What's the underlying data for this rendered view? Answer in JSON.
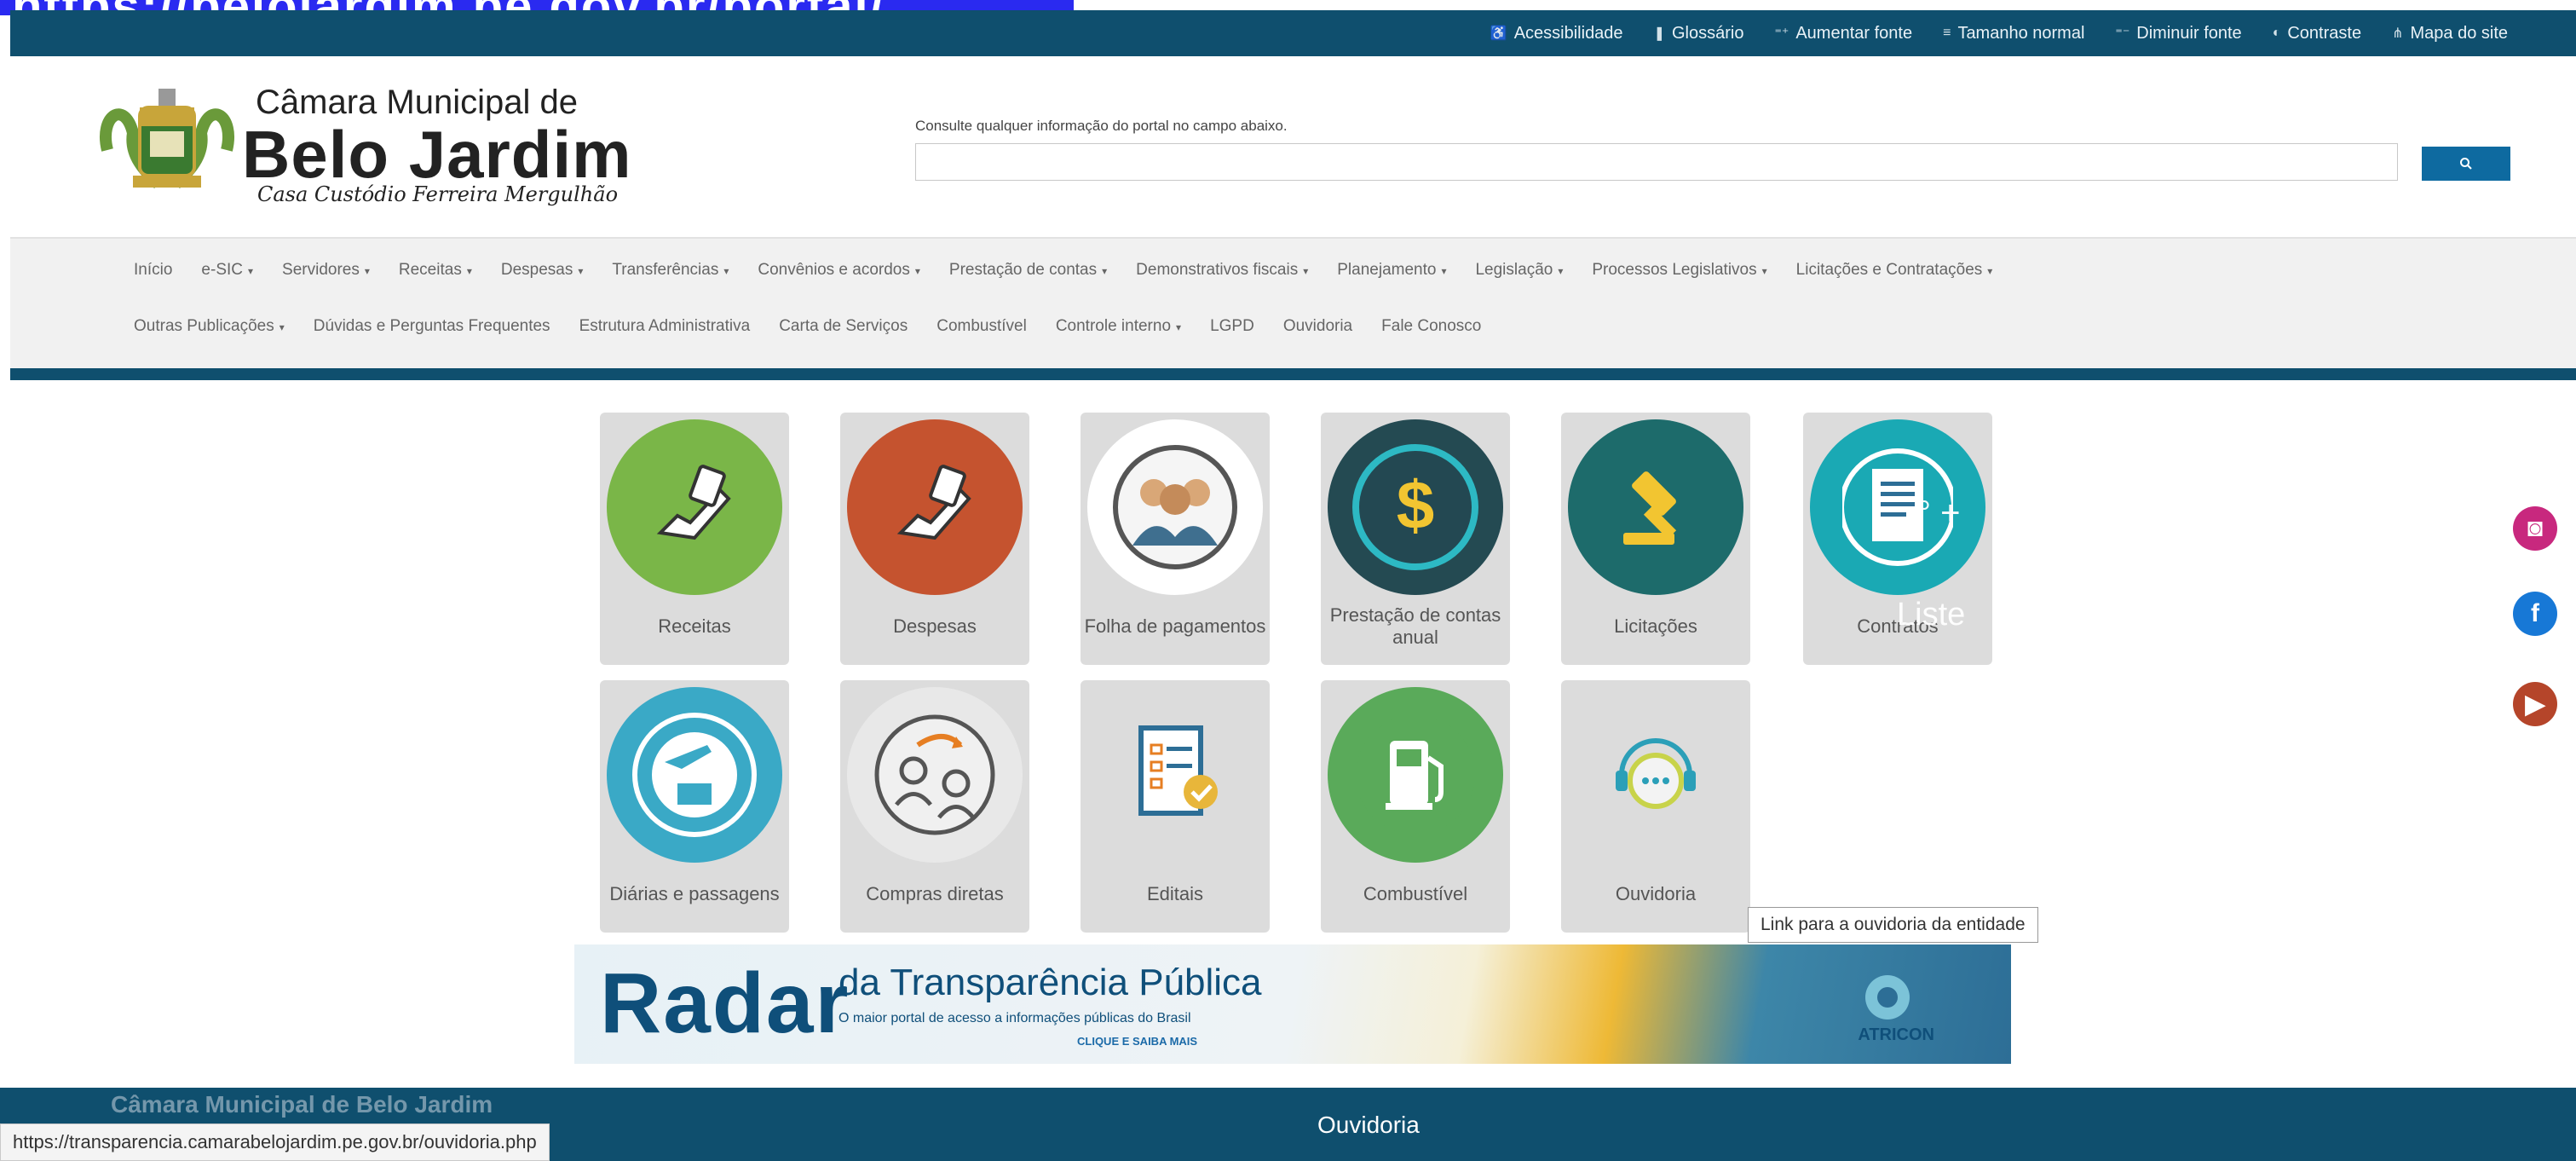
{
  "top_overlay_url": "https://belojardim.pe.gov.br/portal/",
  "access_bar": {
    "items": [
      {
        "icon": "accessibility-icon",
        "glyph": "♿",
        "label": "Acessibilidade"
      },
      {
        "icon": "book-icon",
        "glyph": "❚",
        "label": "Glossário"
      },
      {
        "icon": "font-increase-icon",
        "glyph": "⁼⁺",
        "label": "Aumentar fonte"
      },
      {
        "icon": "font-normal-icon",
        "glyph": "≡",
        "label": "Tamanho normal"
      },
      {
        "icon": "font-decrease-icon",
        "glyph": "⁼⁻",
        "label": "Diminuir fonte"
      },
      {
        "icon": "contrast-icon",
        "glyph": "◐",
        "label": "Contraste"
      },
      {
        "icon": "sitemap-icon",
        "glyph": "⋔",
        "label": "Mapa do site"
      }
    ]
  },
  "header": {
    "logo_line1": "Câmara Municipal de",
    "logo_line2": "Belo Jardim",
    "logo_line3": "Casa Custódio Ferreira Mergulhão",
    "search_label": "Consulte qualquer informação do portal no campo abaixo.",
    "search_value": ""
  },
  "nav": {
    "row1": [
      {
        "label": "Início",
        "dropdown": false
      },
      {
        "label": "e-SIC",
        "dropdown": true
      },
      {
        "label": "Servidores",
        "dropdown": true
      },
      {
        "label": "Receitas",
        "dropdown": true
      },
      {
        "label": "Despesas",
        "dropdown": true
      },
      {
        "label": "Transferências",
        "dropdown": true
      },
      {
        "label": "Convênios e acordos",
        "dropdown": true
      },
      {
        "label": "Prestação de contas",
        "dropdown": true
      },
      {
        "label": "Demonstrativos fiscais",
        "dropdown": true
      },
      {
        "label": "Planejamento",
        "dropdown": true
      },
      {
        "label": "Legislação",
        "dropdown": true
      },
      {
        "label": "Processos Legislativos",
        "dropdown": true
      },
      {
        "label": "Licitações e Contratações",
        "dropdown": true
      }
    ],
    "row2": [
      {
        "label": "Outras Publicações",
        "dropdown": true
      },
      {
        "label": "Dúvidas e Perguntas Frequentes",
        "dropdown": false
      },
      {
        "label": "Estrutura Administrativa",
        "dropdown": false
      },
      {
        "label": "Carta de Serviços",
        "dropdown": false
      },
      {
        "label": "Combustível",
        "dropdown": false
      },
      {
        "label": "Controle interno",
        "dropdown": true
      },
      {
        "label": "LGPD",
        "dropdown": false
      },
      {
        "label": "Ouvidoria",
        "dropdown": false
      },
      {
        "label": "Fale Conosco",
        "dropdown": false
      }
    ]
  },
  "tiles": [
    {
      "label": "Receitas",
      "icon": "money-hand-icon",
      "color": "#7ab648"
    },
    {
      "label": "Despesas",
      "icon": "money-hand-icon",
      "color": "#c5532f"
    },
    {
      "label": "Folha de pagamentos",
      "icon": "people-group-icon",
      "color": "#ffffff"
    },
    {
      "label": "Prestação de contas anual",
      "icon": "dollar-icon",
      "color": "#244a52"
    },
    {
      "label": "Licitações",
      "icon": "gavel-icon",
      "color": "#1d6b6b"
    },
    {
      "label": "Contratos",
      "icon": "document-icon",
      "color": "#1aa9b4"
    },
    {
      "label": "Diárias e passagens",
      "icon": "travel-icon",
      "color": "#3aa9c6"
    },
    {
      "label": "Compras diretas",
      "icon": "exchange-users-icon",
      "color": "#e8e8e8"
    },
    {
      "label": "Editais",
      "icon": "checklist-icon",
      "color": "#dcdcdc"
    },
    {
      "label": "Combustível",
      "icon": "fuel-pump-icon",
      "color": "#5aaa5a"
    },
    {
      "label": "Ouvidoria",
      "icon": "chat-support-icon",
      "color": "#dcdcdc"
    }
  ],
  "tile_overlay_text": {
    "plus": "° +",
    "liste": "Liste"
  },
  "tooltip": "Link para a ouvidoria da entidade",
  "banner": {
    "radar": "Radar",
    "title": "da Transparência Pública",
    "subtitle": "O maior portal de acesso a informações públicas do Brasil",
    "cta": "CLIQUE E SAIBA MAIS",
    "brand": "ATRICON"
  },
  "social": [
    {
      "icon": "instagram-icon",
      "glyph": "◙",
      "color": "#c8287e"
    },
    {
      "icon": "facebook-icon",
      "glyph": "f",
      "color": "#1778d6"
    },
    {
      "icon": "youtube-icon",
      "glyph": "▶",
      "color": "#b5452a"
    }
  ],
  "footer": {
    "title": "Câmara Municipal de Belo Jardim",
    "column_title": "Ouvidoria"
  },
  "status_bar_url": "https://transparencia.camarabelojardim.pe.gov.br/ouvidoria.php"
}
